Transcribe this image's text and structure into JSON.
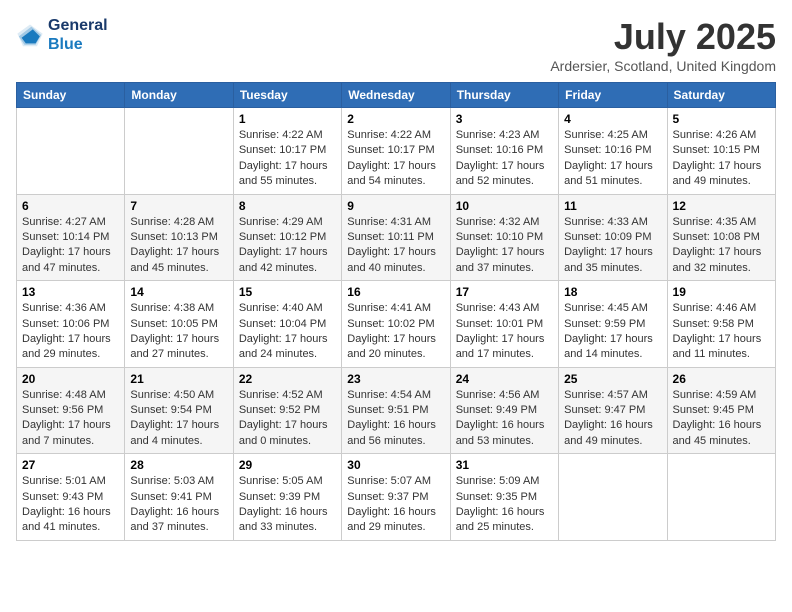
{
  "logo": {
    "line1": "General",
    "line2": "Blue"
  },
  "title": "July 2025",
  "location": "Ardersier, Scotland, United Kingdom",
  "days_header": [
    "Sunday",
    "Monday",
    "Tuesday",
    "Wednesday",
    "Thursday",
    "Friday",
    "Saturday"
  ],
  "weeks": [
    [
      {
        "day": "",
        "info": ""
      },
      {
        "day": "",
        "info": ""
      },
      {
        "day": "1",
        "info": "Sunrise: 4:22 AM\nSunset: 10:17 PM\nDaylight: 17 hours and 55 minutes."
      },
      {
        "day": "2",
        "info": "Sunrise: 4:22 AM\nSunset: 10:17 PM\nDaylight: 17 hours and 54 minutes."
      },
      {
        "day": "3",
        "info": "Sunrise: 4:23 AM\nSunset: 10:16 PM\nDaylight: 17 hours and 52 minutes."
      },
      {
        "day": "4",
        "info": "Sunrise: 4:25 AM\nSunset: 10:16 PM\nDaylight: 17 hours and 51 minutes."
      },
      {
        "day": "5",
        "info": "Sunrise: 4:26 AM\nSunset: 10:15 PM\nDaylight: 17 hours and 49 minutes."
      }
    ],
    [
      {
        "day": "6",
        "info": "Sunrise: 4:27 AM\nSunset: 10:14 PM\nDaylight: 17 hours and 47 minutes."
      },
      {
        "day": "7",
        "info": "Sunrise: 4:28 AM\nSunset: 10:13 PM\nDaylight: 17 hours and 45 minutes."
      },
      {
        "day": "8",
        "info": "Sunrise: 4:29 AM\nSunset: 10:12 PM\nDaylight: 17 hours and 42 minutes."
      },
      {
        "day": "9",
        "info": "Sunrise: 4:31 AM\nSunset: 10:11 PM\nDaylight: 17 hours and 40 minutes."
      },
      {
        "day": "10",
        "info": "Sunrise: 4:32 AM\nSunset: 10:10 PM\nDaylight: 17 hours and 37 minutes."
      },
      {
        "day": "11",
        "info": "Sunrise: 4:33 AM\nSunset: 10:09 PM\nDaylight: 17 hours and 35 minutes."
      },
      {
        "day": "12",
        "info": "Sunrise: 4:35 AM\nSunset: 10:08 PM\nDaylight: 17 hours and 32 minutes."
      }
    ],
    [
      {
        "day": "13",
        "info": "Sunrise: 4:36 AM\nSunset: 10:06 PM\nDaylight: 17 hours and 29 minutes."
      },
      {
        "day": "14",
        "info": "Sunrise: 4:38 AM\nSunset: 10:05 PM\nDaylight: 17 hours and 27 minutes."
      },
      {
        "day": "15",
        "info": "Sunrise: 4:40 AM\nSunset: 10:04 PM\nDaylight: 17 hours and 24 minutes."
      },
      {
        "day": "16",
        "info": "Sunrise: 4:41 AM\nSunset: 10:02 PM\nDaylight: 17 hours and 20 minutes."
      },
      {
        "day": "17",
        "info": "Sunrise: 4:43 AM\nSunset: 10:01 PM\nDaylight: 17 hours and 17 minutes."
      },
      {
        "day": "18",
        "info": "Sunrise: 4:45 AM\nSunset: 9:59 PM\nDaylight: 17 hours and 14 minutes."
      },
      {
        "day": "19",
        "info": "Sunrise: 4:46 AM\nSunset: 9:58 PM\nDaylight: 17 hours and 11 minutes."
      }
    ],
    [
      {
        "day": "20",
        "info": "Sunrise: 4:48 AM\nSunset: 9:56 PM\nDaylight: 17 hours and 7 minutes."
      },
      {
        "day": "21",
        "info": "Sunrise: 4:50 AM\nSunset: 9:54 PM\nDaylight: 17 hours and 4 minutes."
      },
      {
        "day": "22",
        "info": "Sunrise: 4:52 AM\nSunset: 9:52 PM\nDaylight: 17 hours and 0 minutes."
      },
      {
        "day": "23",
        "info": "Sunrise: 4:54 AM\nSunset: 9:51 PM\nDaylight: 16 hours and 56 minutes."
      },
      {
        "day": "24",
        "info": "Sunrise: 4:56 AM\nSunset: 9:49 PM\nDaylight: 16 hours and 53 minutes."
      },
      {
        "day": "25",
        "info": "Sunrise: 4:57 AM\nSunset: 9:47 PM\nDaylight: 16 hours and 49 minutes."
      },
      {
        "day": "26",
        "info": "Sunrise: 4:59 AM\nSunset: 9:45 PM\nDaylight: 16 hours and 45 minutes."
      }
    ],
    [
      {
        "day": "27",
        "info": "Sunrise: 5:01 AM\nSunset: 9:43 PM\nDaylight: 16 hours and 41 minutes."
      },
      {
        "day": "28",
        "info": "Sunrise: 5:03 AM\nSunset: 9:41 PM\nDaylight: 16 hours and 37 minutes."
      },
      {
        "day": "29",
        "info": "Sunrise: 5:05 AM\nSunset: 9:39 PM\nDaylight: 16 hours and 33 minutes."
      },
      {
        "day": "30",
        "info": "Sunrise: 5:07 AM\nSunset: 9:37 PM\nDaylight: 16 hours and 29 minutes."
      },
      {
        "day": "31",
        "info": "Sunrise: 5:09 AM\nSunset: 9:35 PM\nDaylight: 16 hours and 25 minutes."
      },
      {
        "day": "",
        "info": ""
      },
      {
        "day": "",
        "info": ""
      }
    ]
  ]
}
